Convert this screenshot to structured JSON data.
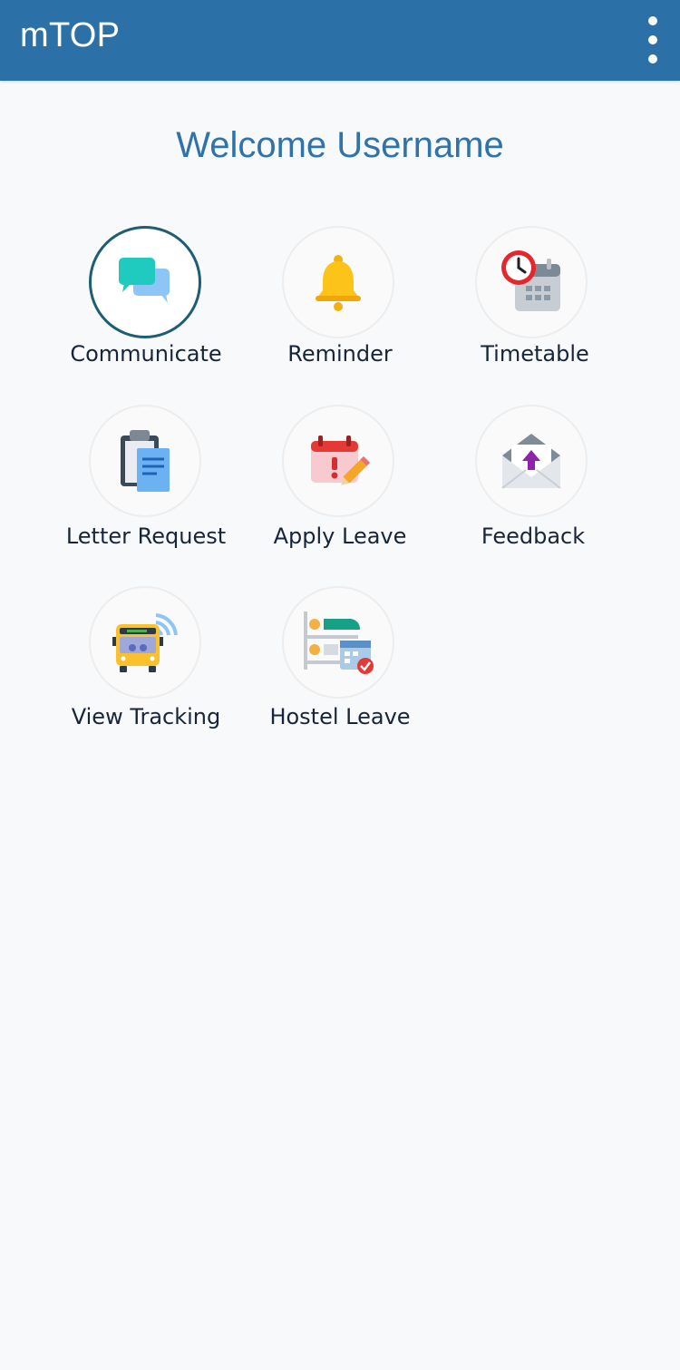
{
  "app_bar": {
    "title": "mTOP",
    "menu_icon": "more-vertical-icon",
    "background_color": "#2b71a8"
  },
  "welcome_text": "Welcome Username",
  "menu_items": [
    {
      "label": "Communicate",
      "icon": "chat-bubbles-icon",
      "selected": true
    },
    {
      "label": "Reminder",
      "icon": "bell-icon"
    },
    {
      "label": "Timetable",
      "icon": "clock-calendar-icon"
    },
    {
      "label": "Letter Request",
      "icon": "clipboard-document-icon"
    },
    {
      "label": "Apply Leave",
      "icon": "calendar-alert-pencil-icon"
    },
    {
      "label": "Feedback",
      "icon": "envelope-upload-icon"
    },
    {
      "label": "View Tracking",
      "icon": "bus-tracking-icon"
    },
    {
      "label": "Hostel Leave",
      "icon": "bunk-bed-calendar-icon"
    }
  ]
}
